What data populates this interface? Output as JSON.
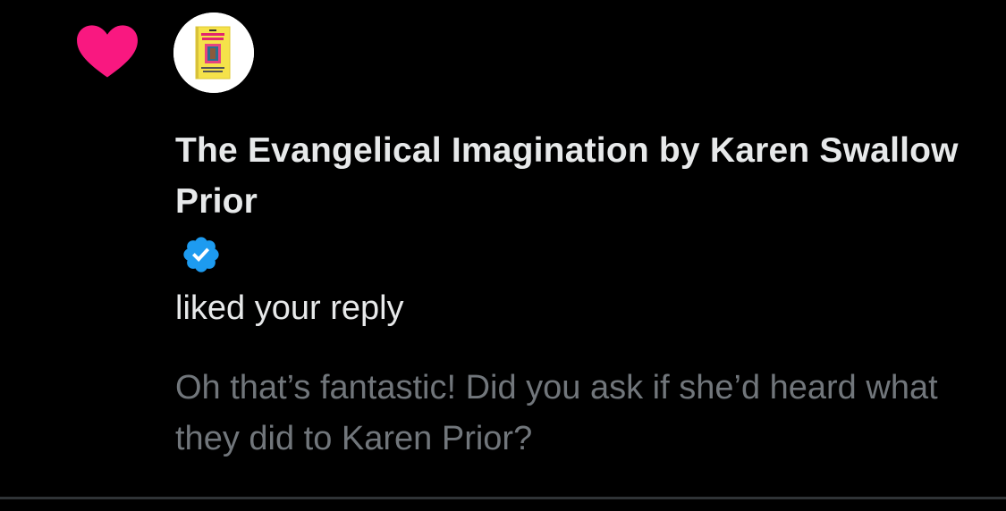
{
  "notification": {
    "type_icon": "heart-icon",
    "type_icon_color": "#f91880",
    "avatar": {
      "description_icon": "book-cover-avatar"
    },
    "author_name": "The Evangelical Imagination by Karen Swallow Prior",
    "verified_badge": {
      "icon": "verified-badge-icon",
      "color": "#1d9bf0"
    },
    "action_text": "liked your reply",
    "reply_text": "Oh that’s fantastic! Did you ask if she’d heard what they did to Karen Prior?"
  },
  "colors": {
    "background": "#000000",
    "primary_text": "#e7e9ea",
    "secondary_text": "#71767b",
    "divider": "#2f3336"
  }
}
